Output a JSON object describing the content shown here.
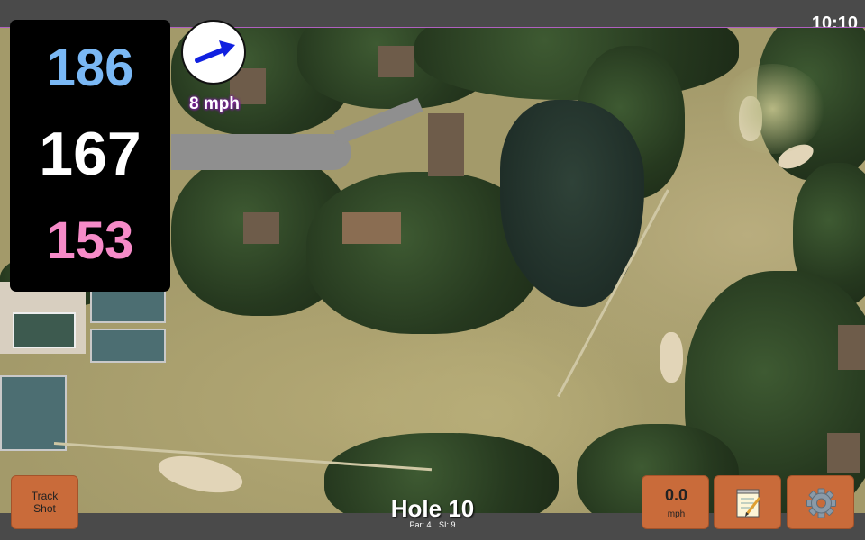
{
  "status_bar": {
    "time": "10:10"
  },
  "distances": {
    "back": "186",
    "center": "167",
    "front": "153"
  },
  "wind": {
    "speed": "8 mph",
    "arrow_color": "#1020e0"
  },
  "hole": {
    "title": "Hole 10",
    "par": "Par: 4",
    "stroke_index": "SI: 9"
  },
  "buttons": {
    "track_shot_line1": "Track",
    "track_shot_line2": "Shot",
    "speed_value": "0.0",
    "speed_unit": "mph",
    "notes_icon": "notepad-icon",
    "settings_icon": "gear-icon"
  },
  "colors": {
    "back_distance": "#7ab8f5",
    "center_distance": "#ffffff",
    "front_distance": "#f68bc8",
    "button": "#c96b3a"
  }
}
